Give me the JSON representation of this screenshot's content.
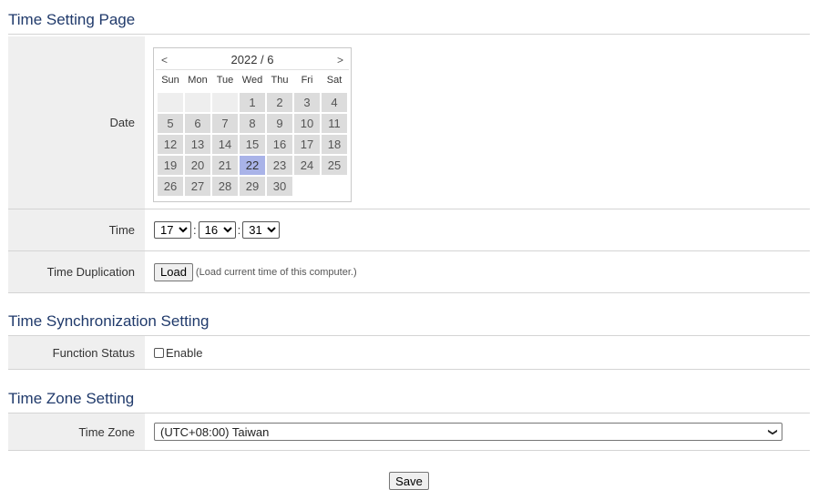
{
  "time_setting": {
    "title": "Time Setting Page",
    "date_label": "Date",
    "calendar": {
      "prev": "<",
      "month_label": "2022 / 6",
      "next": ">",
      "weekdays": [
        "Sun",
        "Mon",
        "Tue",
        "Wed",
        "Thu",
        "Fri",
        "Sat"
      ],
      "leading_blanks": 3,
      "days": [
        "1",
        "2",
        "3",
        "4",
        "5",
        "6",
        "7",
        "8",
        "9",
        "10",
        "11",
        "12",
        "13",
        "14",
        "15",
        "16",
        "17",
        "18",
        "19",
        "20",
        "21",
        "22",
        "23",
        "24",
        "25",
        "26",
        "27",
        "28",
        "29",
        "30"
      ],
      "selected_day": "22"
    },
    "time_label": "Time",
    "hour": "17",
    "minute": "16",
    "second": "31",
    "separator": ":",
    "dup_label": "Time Duplication",
    "load_button": "Load",
    "load_hint": "(Load current time of this computer.)"
  },
  "sync": {
    "title": "Time Synchronization Setting",
    "status_label": "Function Status",
    "enable_label": "Enable"
  },
  "zone": {
    "title": "Time Zone Setting",
    "label": "Time Zone",
    "value": "(UTC+08:00) Taiwan"
  },
  "save_button": "Save",
  "colors": {
    "title": "#203a6b",
    "label_bg": "#efefef",
    "selected_day": "#a9b3e8",
    "day_bg": "#dcdcdc"
  }
}
